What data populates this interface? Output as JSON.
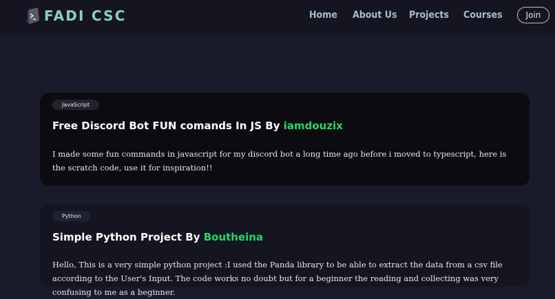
{
  "brand": {
    "name": "FADI CSC",
    "logo_icon": "terminal-prompt-icon",
    "accent_color": "#8fd0bc"
  },
  "nav": {
    "links": [
      {
        "label": "Home"
      },
      {
        "label": "About Us"
      },
      {
        "label": "Projects"
      },
      {
        "label": "Courses"
      }
    ],
    "join_label": "Join"
  },
  "colors": {
    "background": "#1a1b2a",
    "navbar": "#141520",
    "author_link": "#27d667"
  },
  "projects": [
    {
      "tag": "JavaScript",
      "title": "Free Discord Bot FUN comands In JS",
      "by": "By",
      "author": "iamdouzix",
      "description": "I made some fun commands in javascript for my discord bot a long time ago before i moved to typescript, here is the scratch code, use it for inspiration!!"
    },
    {
      "tag": "Python",
      "title": "Simple Python Project",
      "by": "By",
      "author": "Boutheina",
      "description": "Hello, This is a very simple python project :I used the Panda library to be able to extract the data from a csv file according to the User's Input. The code works no doubt but for a beginner the reading and collecting was very confusing to me as a beginner."
    }
  ]
}
